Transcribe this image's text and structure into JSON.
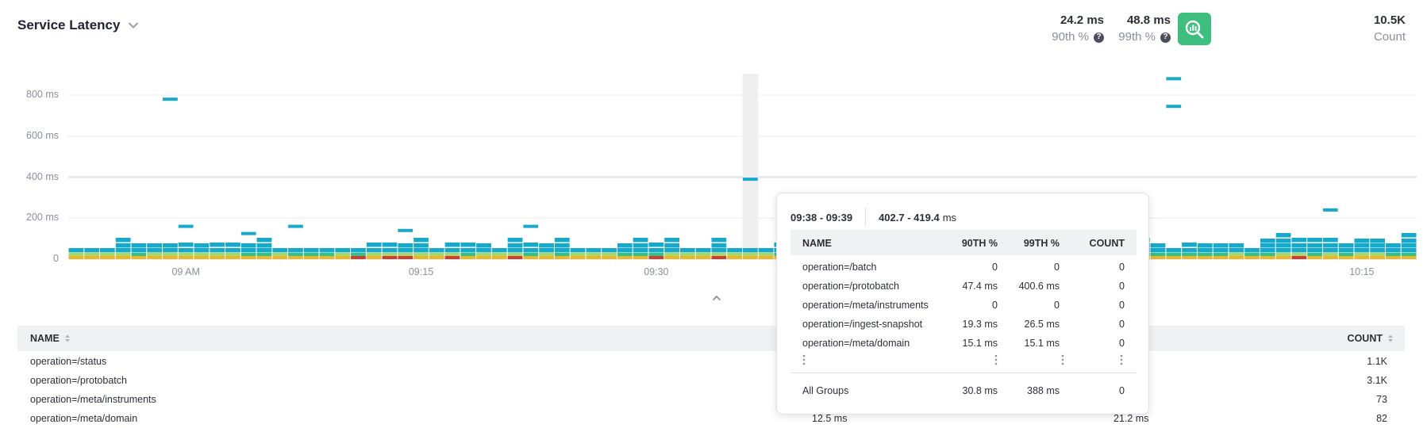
{
  "header": {
    "title": "Service Latency",
    "kpis": [
      {
        "value": "24.2 ms",
        "label": "90th %",
        "help": "?"
      },
      {
        "value": "48.8 ms",
        "label": "99th %",
        "help": "?"
      },
      {
        "value": "10.5K",
        "label": "Count"
      }
    ]
  },
  "colors": {
    "accent": "#3fbf7f",
    "heat_low": "#17a9c9",
    "heat_mid": "#2fc28a",
    "heat_high": "#f0b429",
    "heat_max": "#d63b2f",
    "band": "#efefef"
  },
  "chart_data": {
    "type": "heatmap",
    "y_ticks": [
      "800 ms",
      "600 ms",
      "400 ms",
      "200 ms",
      "0"
    ],
    "x_ticks": [
      "09 AM",
      "09:15",
      "09:30",
      "10:15"
    ],
    "ylim": [
      0,
      900
    ],
    "highlight_window": "09:38 - 09:39",
    "outliers_ms": [
      780,
      160,
      125,
      160,
      140,
      160,
      390,
      880,
      745,
      240
    ]
  },
  "chart_marks": {
    "y_axis": [
      {
        "name": "y-tick-800",
        "label": "800 ms",
        "value": 800
      },
      {
        "name": "y-tick-600",
        "label": "600 ms",
        "value": 600
      },
      {
        "name": "y-tick-400",
        "label": "400 ms",
        "value": 400
      },
      {
        "name": "y-tick-200",
        "label": "200 ms",
        "value": 200
      },
      {
        "name": "y-tick-0",
        "label": "0",
        "value": 0
      }
    ],
    "x_axis": [
      {
        "name": "x-tick-09am",
        "label": "09 AM",
        "col": 7
      },
      {
        "name": "x-tick-0915",
        "label": "09:15",
        "col": 22
      },
      {
        "name": "x-tick-0930",
        "label": "09:30",
        "col": 37
      },
      {
        "name": "x-tick-1015",
        "label": "10:15",
        "col": 82
      }
    ]
  },
  "table": {
    "headers": {
      "name": "NAME",
      "count": "COUNT"
    },
    "rows": [
      {
        "name": "operation=/status",
        "count": "1.1K"
      },
      {
        "name": "operation=/protobatch",
        "count": "3.1K"
      },
      {
        "name": "operation=/meta/instruments",
        "count": "73"
      },
      {
        "name": "operation=/meta/domain",
        "p90": "12.5 ms",
        "p99": "21.2 ms",
        "count": "82"
      }
    ]
  },
  "tooltip": {
    "time_range": "09:38 - 09:39",
    "latency_range": "402.7 - 419.4",
    "latency_unit": "ms",
    "headers": {
      "name": "NAME",
      "p90": "90TH %",
      "p99": "99TH %",
      "count": "COUNT"
    },
    "rows": [
      {
        "name": "operation=/batch",
        "p90": "0",
        "p99": "0",
        "count": "0"
      },
      {
        "name": "operation=/protobatch",
        "p90": "47.4 ms",
        "p99": "400.6 ms",
        "count": "0"
      },
      {
        "name": "operation=/meta/instruments",
        "p90": "0",
        "p99": "0",
        "count": "0"
      },
      {
        "name": "operation=/ingest-snapshot",
        "p90": "19.3 ms",
        "p99": "26.5 ms",
        "count": "0"
      },
      {
        "name": "operation=/meta/domain",
        "p90": "15.1 ms",
        "p99": "15.1 ms",
        "count": "0"
      }
    ],
    "total": {
      "name": "All Groups",
      "p90": "30.8 ms",
      "p99": "388 ms",
      "count": "0"
    }
  }
}
